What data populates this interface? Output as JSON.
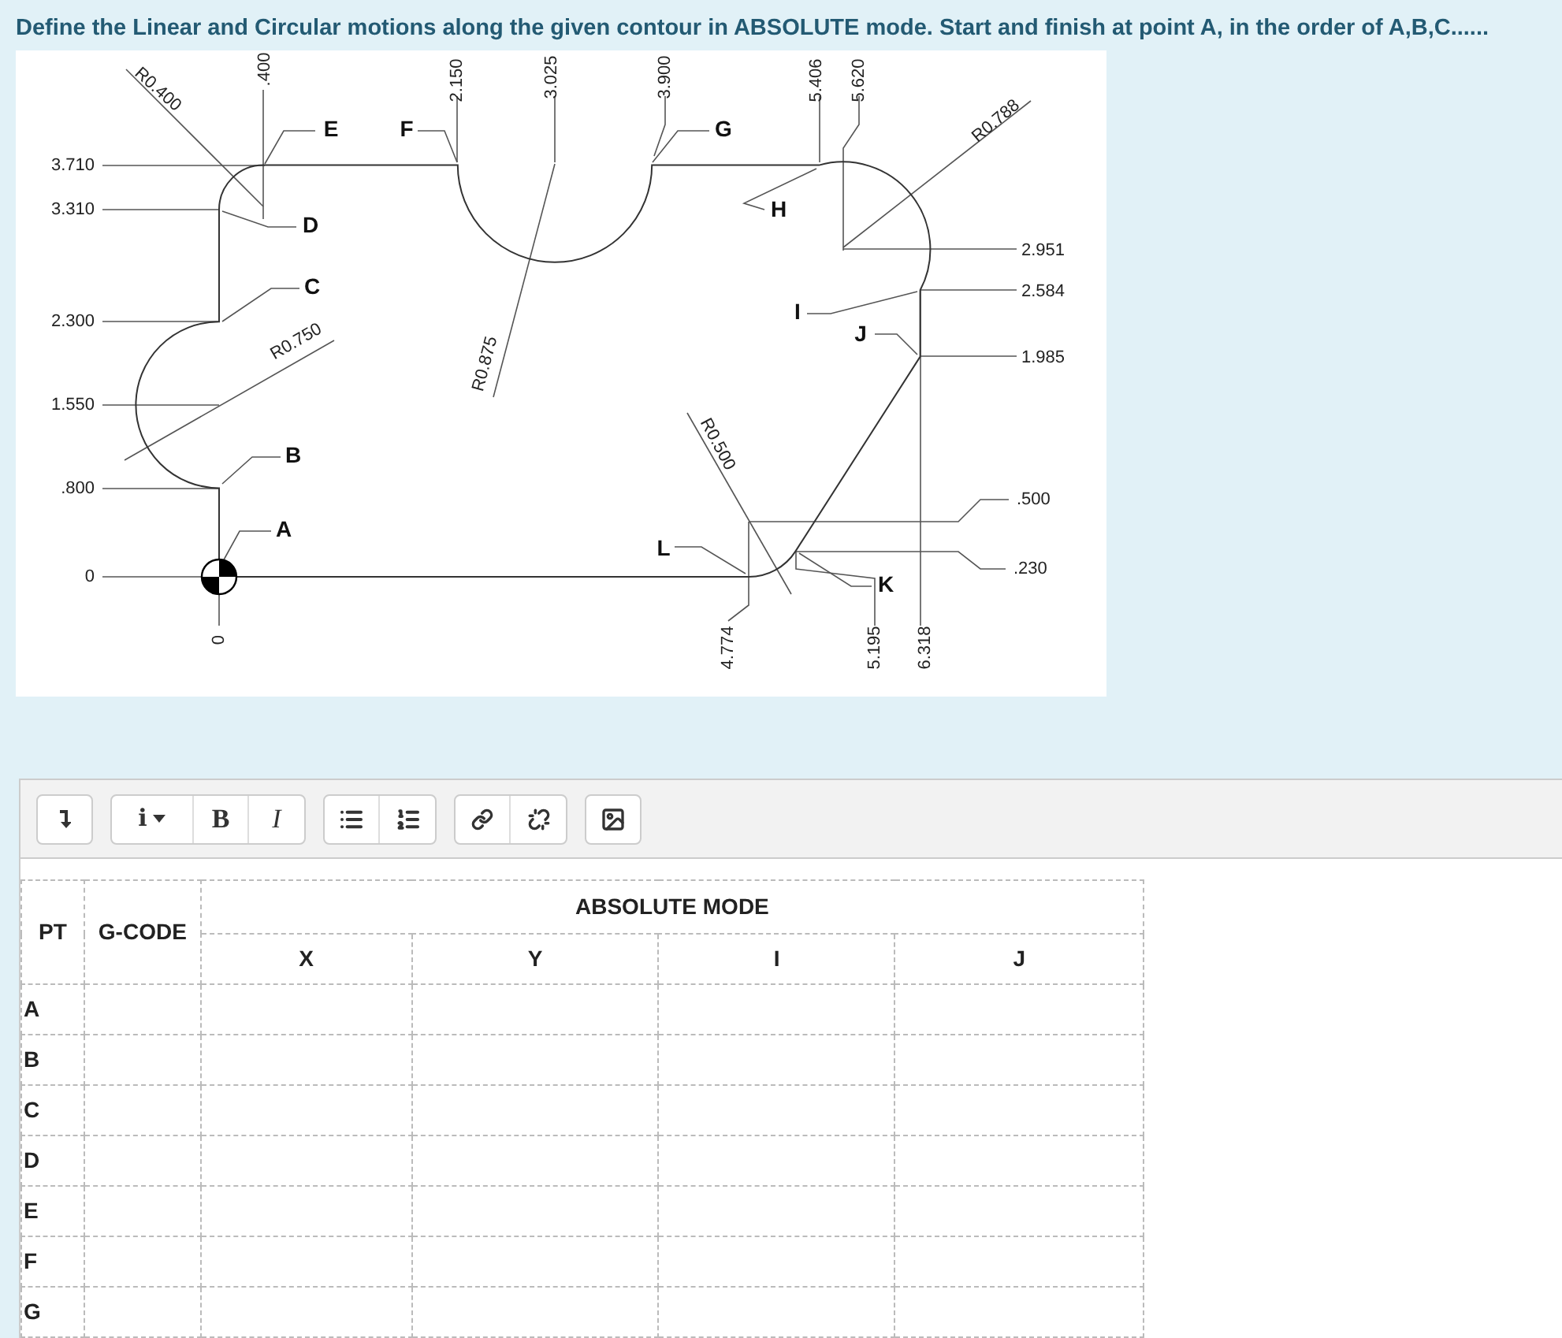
{
  "question": "Define the Linear and Circular motions along the given contour in ABSOLUTE mode. Start and finish at point A, in the order of A,B,C......",
  "drawing": {
    "y_dims": [
      "3.710",
      "3.310",
      "2.300",
      "1.550",
      ".800",
      "0"
    ],
    "top_dims": [
      ".400",
      "2.150",
      "3.025",
      "3.900",
      "5.406",
      "5.620"
    ],
    "bottom_dims": [
      "0",
      "4.774",
      "5.195",
      "6.318"
    ],
    "right_dims": [
      "2.951",
      "2.584",
      "1.985",
      ".500",
      ".230"
    ],
    "radii": [
      "R0.400",
      "R0.750",
      "R0.875",
      "R0.500",
      "R0.788"
    ],
    "points": [
      "A",
      "B",
      "C",
      "D",
      "E",
      "F",
      "G",
      "H",
      "I",
      "J",
      "K",
      "L"
    ]
  },
  "toolbar": [
    [
      {
        "kind": "collapse"
      }
    ],
    [
      {
        "kind": "style",
        "label": "i"
      },
      {
        "kind": "bold",
        "label": "B"
      },
      {
        "kind": "italic",
        "label": "I"
      }
    ],
    [
      {
        "kind": "bullets"
      },
      {
        "kind": "numbered"
      }
    ],
    [
      {
        "kind": "link"
      },
      {
        "kind": "unlink"
      }
    ],
    [
      {
        "kind": "image"
      }
    ]
  ],
  "table": {
    "group_header": "ABSOLUTE MODE",
    "columns": [
      "PT",
      "G-CODE",
      "X",
      "Y",
      "I",
      "J"
    ],
    "rows": [
      {
        "pt": "A"
      },
      {
        "pt": "B"
      },
      {
        "pt": "C"
      },
      {
        "pt": "D"
      },
      {
        "pt": "E"
      },
      {
        "pt": "F"
      },
      {
        "pt": "G"
      }
    ]
  }
}
